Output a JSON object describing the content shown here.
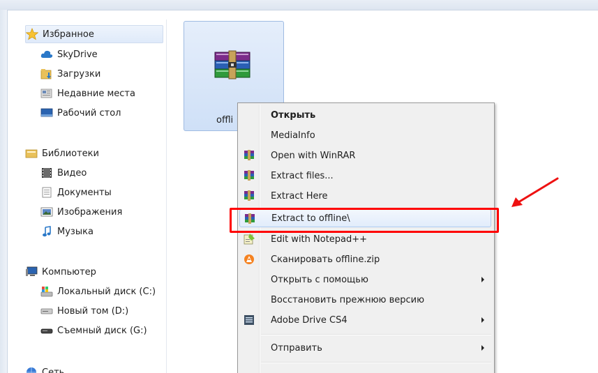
{
  "nav": {
    "favorites": {
      "label": "Избранное",
      "icon": "star-icon"
    },
    "favorites_items": [
      {
        "label": "SkyDrive",
        "icon": "cloud-icon"
      },
      {
        "label": "Загрузки",
        "icon": "downloads-folder-icon"
      },
      {
        "label": "Недавние места",
        "icon": "recent-places-icon"
      },
      {
        "label": "Рабочий стол",
        "icon": "desktop-icon"
      }
    ],
    "libraries": {
      "label": "Библиотеки",
      "icon": "libraries-icon"
    },
    "libraries_items": [
      {
        "label": "Видео",
        "icon": "video-icon"
      },
      {
        "label": "Документы",
        "icon": "documents-icon"
      },
      {
        "label": "Изображения",
        "icon": "pictures-icon"
      },
      {
        "label": "Музыка",
        "icon": "music-icon"
      }
    ],
    "computer": {
      "label": "Компьютер",
      "icon": "computer-icon"
    },
    "computer_items": [
      {
        "label": "Локальный диск (C:)",
        "icon": "local-disk-icon"
      },
      {
        "label": "Новый том (D:)",
        "icon": "drive-icon"
      },
      {
        "label": "Съемный диск (G:)",
        "icon": "removable-drive-icon"
      }
    ],
    "network": {
      "label": "Сеть",
      "icon": "network-icon"
    }
  },
  "file": {
    "label": "offli",
    "icon": "winrar-archive-icon"
  },
  "context_menu": {
    "items": [
      {
        "label": "Открыть",
        "icon": "",
        "bold": true,
        "submenu": false
      },
      {
        "label": "MediaInfo",
        "icon": "",
        "bold": false,
        "submenu": false
      },
      {
        "label": "Open with WinRAR",
        "icon": "winrar-icon",
        "bold": false,
        "submenu": false
      },
      {
        "label": "Extract files...",
        "icon": "winrar-icon",
        "bold": false,
        "submenu": false
      },
      {
        "label": "Extract Here",
        "icon": "winrar-icon",
        "bold": false,
        "submenu": false
      },
      {
        "label": "Extract to offline\\",
        "icon": "winrar-icon",
        "bold": false,
        "submenu": false,
        "highlighted": true
      },
      {
        "label": "Edit with Notepad++",
        "icon": "notepadpp-icon",
        "bold": false,
        "submenu": false
      },
      {
        "label": "Сканировать offline.zip",
        "icon": "avast-icon",
        "bold": false,
        "submenu": false
      },
      {
        "label": "Открыть с помощью",
        "icon": "",
        "bold": false,
        "submenu": true
      },
      {
        "label": "Восстановить прежнюю версию",
        "icon": "",
        "bold": false,
        "submenu": false
      },
      {
        "label": "Adobe Drive CS4",
        "icon": "adobe-drive-icon",
        "bold": false,
        "submenu": true
      },
      {
        "label": "Отправить",
        "icon": "",
        "bold": false,
        "submenu": true
      }
    ]
  },
  "colors": {
    "annotation": "#ff0000",
    "hover_border": "#aecbf1",
    "menu_bg": "#f0f0f0"
  }
}
